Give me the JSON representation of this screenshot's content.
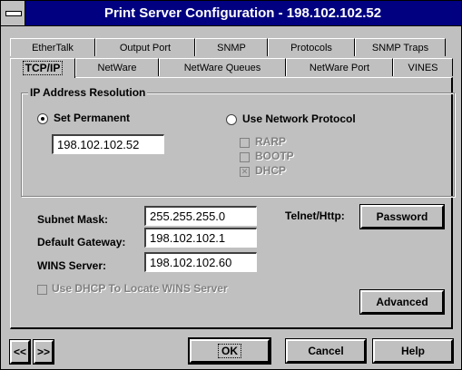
{
  "window": {
    "title": "Print Server Configuration - 198.102.102.52"
  },
  "tabs": {
    "row1": [
      "EtherTalk",
      "Output Port",
      "SNMP",
      "Protocols",
      "SNMP Traps"
    ],
    "row2": [
      "TCP/IP",
      "NetWare",
      "NetWare Queues",
      "NetWare Port",
      "VINES"
    ]
  },
  "ip_resolution": {
    "group_label": "IP Address Resolution",
    "set_permanent_label": "Set Permanent",
    "set_permanent_selected": true,
    "ip_value": "198.102.102.52",
    "use_network_label": "Use Network Protocol",
    "protocols": [
      {
        "label": "RARP",
        "checked": false
      },
      {
        "label": "BOOTP",
        "checked": false
      },
      {
        "label": "DHCP",
        "checked": true
      }
    ]
  },
  "network": {
    "subnet_label": "Subnet Mask:",
    "subnet_value": "255.255.255.0",
    "gateway_label": "Default Gateway:",
    "gateway_value": "198.102.102.1",
    "wins_label": "WINS Server:",
    "wins_value": "198.102.102.60",
    "telnet_label": "Telnet/Http:",
    "password_button": "Password",
    "dhcp_wins_label": "Use DHCP To Locate WINS Server",
    "advanced_button": "Advanced"
  },
  "footer": {
    "prev_button": "<<",
    "next_button": ">>",
    "ok_button": "OK",
    "cancel_button": "Cancel",
    "help_button": "Help"
  }
}
